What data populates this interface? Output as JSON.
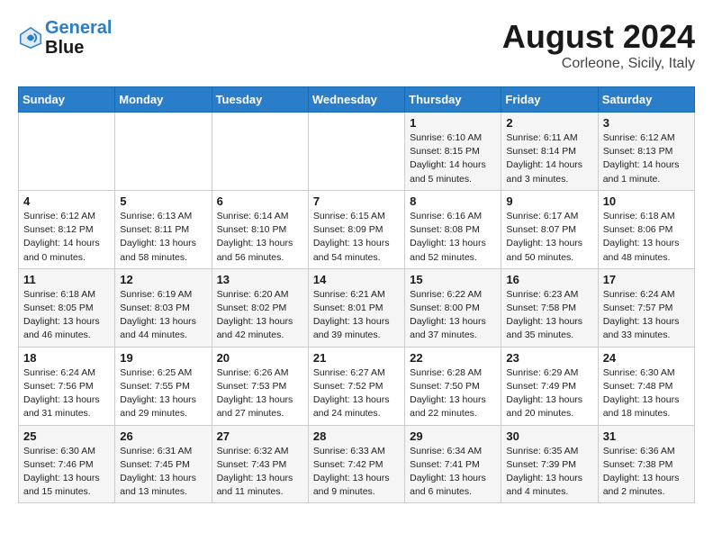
{
  "header": {
    "logo_line1": "General",
    "logo_line2": "Blue",
    "month": "August 2024",
    "location": "Corleone, Sicily, Italy"
  },
  "days_of_week": [
    "Sunday",
    "Monday",
    "Tuesday",
    "Wednesday",
    "Thursday",
    "Friday",
    "Saturday"
  ],
  "weeks": [
    [
      {
        "day": "",
        "info": ""
      },
      {
        "day": "",
        "info": ""
      },
      {
        "day": "",
        "info": ""
      },
      {
        "day": "",
        "info": ""
      },
      {
        "day": "1",
        "info": "Sunrise: 6:10 AM\nSunset: 8:15 PM\nDaylight: 14 hours\nand 5 minutes."
      },
      {
        "day": "2",
        "info": "Sunrise: 6:11 AM\nSunset: 8:14 PM\nDaylight: 14 hours\nand 3 minutes."
      },
      {
        "day": "3",
        "info": "Sunrise: 6:12 AM\nSunset: 8:13 PM\nDaylight: 14 hours\nand 1 minute."
      }
    ],
    [
      {
        "day": "4",
        "info": "Sunrise: 6:12 AM\nSunset: 8:12 PM\nDaylight: 14 hours\nand 0 minutes."
      },
      {
        "day": "5",
        "info": "Sunrise: 6:13 AM\nSunset: 8:11 PM\nDaylight: 13 hours\nand 58 minutes."
      },
      {
        "day": "6",
        "info": "Sunrise: 6:14 AM\nSunset: 8:10 PM\nDaylight: 13 hours\nand 56 minutes."
      },
      {
        "day": "7",
        "info": "Sunrise: 6:15 AM\nSunset: 8:09 PM\nDaylight: 13 hours\nand 54 minutes."
      },
      {
        "day": "8",
        "info": "Sunrise: 6:16 AM\nSunset: 8:08 PM\nDaylight: 13 hours\nand 52 minutes."
      },
      {
        "day": "9",
        "info": "Sunrise: 6:17 AM\nSunset: 8:07 PM\nDaylight: 13 hours\nand 50 minutes."
      },
      {
        "day": "10",
        "info": "Sunrise: 6:18 AM\nSunset: 8:06 PM\nDaylight: 13 hours\nand 48 minutes."
      }
    ],
    [
      {
        "day": "11",
        "info": "Sunrise: 6:18 AM\nSunset: 8:05 PM\nDaylight: 13 hours\nand 46 minutes."
      },
      {
        "day": "12",
        "info": "Sunrise: 6:19 AM\nSunset: 8:03 PM\nDaylight: 13 hours\nand 44 minutes."
      },
      {
        "day": "13",
        "info": "Sunrise: 6:20 AM\nSunset: 8:02 PM\nDaylight: 13 hours\nand 42 minutes."
      },
      {
        "day": "14",
        "info": "Sunrise: 6:21 AM\nSunset: 8:01 PM\nDaylight: 13 hours\nand 39 minutes."
      },
      {
        "day": "15",
        "info": "Sunrise: 6:22 AM\nSunset: 8:00 PM\nDaylight: 13 hours\nand 37 minutes."
      },
      {
        "day": "16",
        "info": "Sunrise: 6:23 AM\nSunset: 7:58 PM\nDaylight: 13 hours\nand 35 minutes."
      },
      {
        "day": "17",
        "info": "Sunrise: 6:24 AM\nSunset: 7:57 PM\nDaylight: 13 hours\nand 33 minutes."
      }
    ],
    [
      {
        "day": "18",
        "info": "Sunrise: 6:24 AM\nSunset: 7:56 PM\nDaylight: 13 hours\nand 31 minutes."
      },
      {
        "day": "19",
        "info": "Sunrise: 6:25 AM\nSunset: 7:55 PM\nDaylight: 13 hours\nand 29 minutes."
      },
      {
        "day": "20",
        "info": "Sunrise: 6:26 AM\nSunset: 7:53 PM\nDaylight: 13 hours\nand 27 minutes."
      },
      {
        "day": "21",
        "info": "Sunrise: 6:27 AM\nSunset: 7:52 PM\nDaylight: 13 hours\nand 24 minutes."
      },
      {
        "day": "22",
        "info": "Sunrise: 6:28 AM\nSunset: 7:50 PM\nDaylight: 13 hours\nand 22 minutes."
      },
      {
        "day": "23",
        "info": "Sunrise: 6:29 AM\nSunset: 7:49 PM\nDaylight: 13 hours\nand 20 minutes."
      },
      {
        "day": "24",
        "info": "Sunrise: 6:30 AM\nSunset: 7:48 PM\nDaylight: 13 hours\nand 18 minutes."
      }
    ],
    [
      {
        "day": "25",
        "info": "Sunrise: 6:30 AM\nSunset: 7:46 PM\nDaylight: 13 hours\nand 15 minutes."
      },
      {
        "day": "26",
        "info": "Sunrise: 6:31 AM\nSunset: 7:45 PM\nDaylight: 13 hours\nand 13 minutes."
      },
      {
        "day": "27",
        "info": "Sunrise: 6:32 AM\nSunset: 7:43 PM\nDaylight: 13 hours\nand 11 minutes."
      },
      {
        "day": "28",
        "info": "Sunrise: 6:33 AM\nSunset: 7:42 PM\nDaylight: 13 hours\nand 9 minutes."
      },
      {
        "day": "29",
        "info": "Sunrise: 6:34 AM\nSunset: 7:41 PM\nDaylight: 13 hours\nand 6 minutes."
      },
      {
        "day": "30",
        "info": "Sunrise: 6:35 AM\nSunset: 7:39 PM\nDaylight: 13 hours\nand 4 minutes."
      },
      {
        "day": "31",
        "info": "Sunrise: 6:36 AM\nSunset: 7:38 PM\nDaylight: 13 hours\nand 2 minutes."
      }
    ]
  ]
}
